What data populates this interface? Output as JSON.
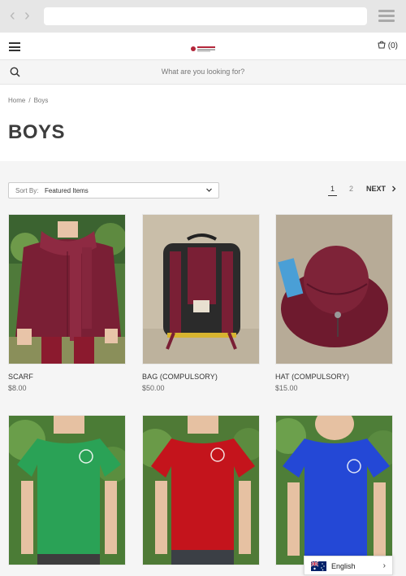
{
  "browser": {
    "back_icon": "chevron-left-icon",
    "forward_icon": "chevron-right-icon",
    "menu_icon": "hamburger-icon"
  },
  "header": {
    "cart_label": "(0)"
  },
  "search": {
    "placeholder": "What are you looking for?"
  },
  "breadcrumb": {
    "items": [
      "Home",
      "Boys"
    ],
    "separator": "/"
  },
  "page_title": "BOYS",
  "sort": {
    "label": "Sort By:",
    "value": "Featured Items"
  },
  "pagination": {
    "current": "1",
    "next_page": "2",
    "next_label": "NEXT"
  },
  "products": [
    {
      "name": "SCARF",
      "price": "$8.00"
    },
    {
      "name": "BAG (COMPULSORY)",
      "price": "$50.00"
    },
    {
      "name": "HAT (COMPULSORY)",
      "price": "$15.00"
    },
    {
      "name": "",
      "price": ""
    },
    {
      "name": "",
      "price": ""
    },
    {
      "name": "",
      "price": ""
    }
  ],
  "language": {
    "label": "English"
  },
  "colors": {
    "maroon": "#7a1f35",
    "green": "#2aa256",
    "red": "#c4141c",
    "blue": "#2448d6"
  }
}
